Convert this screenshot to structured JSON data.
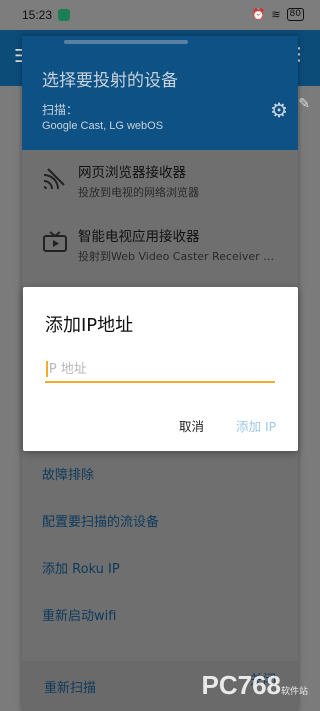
{
  "status_bar": {
    "time": "15:23",
    "battery": "80"
  },
  "sheet": {
    "title": "选择要投射的设备",
    "scan_label": "扫描：",
    "scan_value": "Google Cast, LG webOS",
    "options": [
      {
        "title": "网页浏览器接收器",
        "subtitle": "投放到电视的网络浏览器",
        "icon": "cast-icon"
      },
      {
        "title": "智能电视应用接收器",
        "subtitle": "投射到Web Video Caster Receiver …",
        "icon": "tv-icon"
      }
    ],
    "actions": [
      "故障排除",
      "配置要扫描的流设备",
      "添加 Roku IP",
      "重新启动wifi"
    ],
    "bottom": {
      "rescan": "重新扫描",
      "close": "关闭"
    }
  },
  "dialog": {
    "title": "添加IP地址",
    "placeholder": "IP 地址",
    "cancel": "取消",
    "add": "添加 IP"
  },
  "watermark": {
    "brand": "PC768",
    "sub": "软件站"
  },
  "colors": {
    "accent": "#f2ad2a",
    "header": "#0e5184",
    "add_button": "#9ec8e8"
  }
}
